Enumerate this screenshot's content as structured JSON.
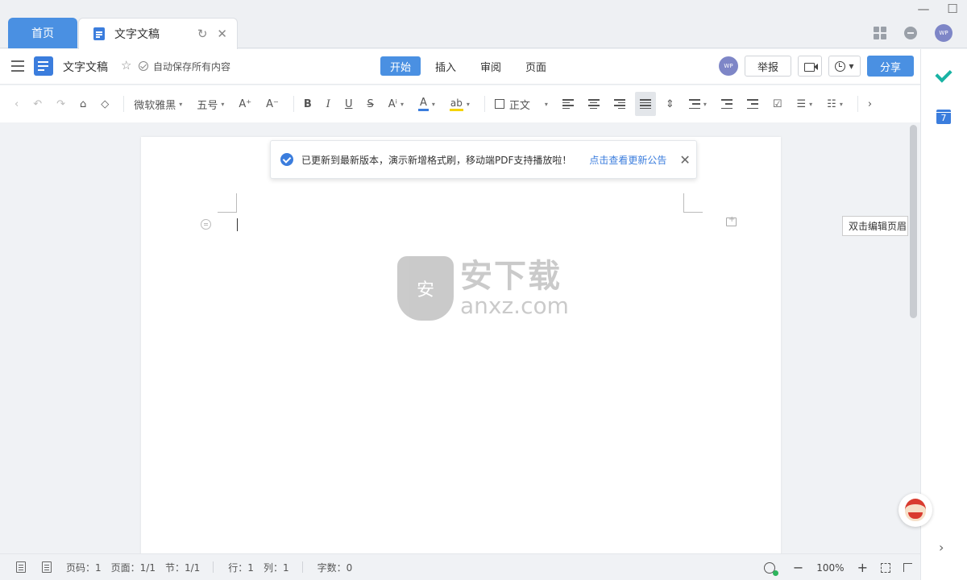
{
  "window": {
    "minimize_glyph": "—",
    "maximize_glyph": "☐"
  },
  "tabs": {
    "home_label": "首页",
    "doc_label": "文字文稿",
    "refresh_glyph": "↻",
    "close_glyph": "✕"
  },
  "top_right": {
    "avatar_text": "WP"
  },
  "header": {
    "doc_title": "文字文稿",
    "star_glyph": "☆",
    "autosave_text": "自动保存所有内容",
    "menu_tabs": [
      "开始",
      "插入",
      "审阅",
      "页面"
    ],
    "active_tab": "开始",
    "avatar_text": "WP",
    "report_label": "举报",
    "share_label": "分享",
    "history_caret": "▾"
  },
  "toolbar": {
    "font_family": "微软雅黑",
    "font_size": "五号",
    "grow_font": "A⁺",
    "shrink_font": "A⁻",
    "bold": "B",
    "italic": "I",
    "underline": "U",
    "strike": "S",
    "superscript": "Aⁱ",
    "font_color": "A",
    "highlight": "ab",
    "style": "正文",
    "caret": "▾",
    "undo_glyph": "↶",
    "redo_glyph": "↷",
    "left_arrow": "‹",
    "right_arrow": "›"
  },
  "notice": {
    "message": "已更新到最新版本，演示新增格式刷，移动端PDF支持播放啦！",
    "link_text": "点击查看更新公告",
    "close_glyph": "✕"
  },
  "tooltip": {
    "text": "双击编辑页眉"
  },
  "watermark": {
    "shield_char": "安",
    "cn_text": "安下载",
    "en_text": "anxz.com"
  },
  "right_rail": {
    "calendar_day": "7",
    "chevron_glyph": "›"
  },
  "statusbar": {
    "page_code": "页码：1",
    "page": "页面：1/1",
    "section": "节：1/1",
    "row": "行：1",
    "col": "列：1",
    "word_count": "字数：0",
    "zoom_out": "−",
    "zoom_level": "100%",
    "zoom_in": "+"
  },
  "colors": {
    "accent": "#4a90e2",
    "link": "#3b7ddd",
    "rail_check": "#19b3a4",
    "highlight_yellow": "#f5d300"
  }
}
